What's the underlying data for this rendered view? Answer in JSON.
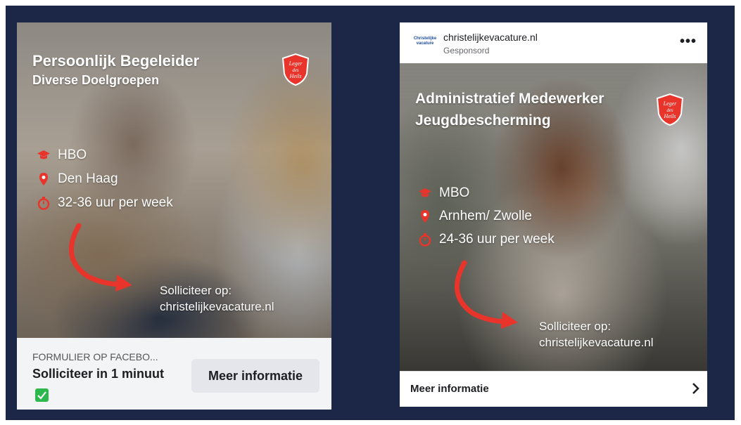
{
  "left_ad": {
    "title": "Persoonlijk Begeleider",
    "subtitle": "Diverse Doelgroepen",
    "logo_text": [
      "Leger",
      "des",
      "Heils"
    ],
    "education": "HBO",
    "location": "Den Haag",
    "hours": "32-36 uur per week",
    "cta_line1": "Solliciteer op:",
    "cta_line2": "christelijkevacature.nl",
    "footer": {
      "form_label": "FORMULIER OP FACEBO...",
      "headline": "Solliciteer in 1 minuut",
      "button_label": "Meer informatie"
    },
    "icons": [
      "graduation-cap-icon",
      "location-pin-icon",
      "stopwatch-icon",
      "checkbox-icon"
    ]
  },
  "right_ad": {
    "page_name": "christelijkevacature.nl",
    "sponsored_label": "Gesponsord",
    "page_logo_text": "Christelijke vacature",
    "menu_glyph": "•••",
    "title_line1": "Administratief Medewerker",
    "title_line2": "Jeugdbescherming",
    "logo_text": [
      "Leger",
      "des",
      "Heils"
    ],
    "education": "MBO",
    "location": "Arnhem/ Zwolle",
    "hours": "24-36 uur per week",
    "cta_line1": "Solliciteer op:",
    "cta_line2": "christelijkevacature.nl",
    "more_label": "Meer informatie",
    "icons": [
      "graduation-cap-icon",
      "location-pin-icon",
      "stopwatch-icon",
      "chevron-right-icon"
    ]
  },
  "colors": {
    "background": "#1c2748",
    "accent_red": "#e8342a",
    "checkbox_green": "#2db84d",
    "button_gray": "#e4e6eb"
  }
}
